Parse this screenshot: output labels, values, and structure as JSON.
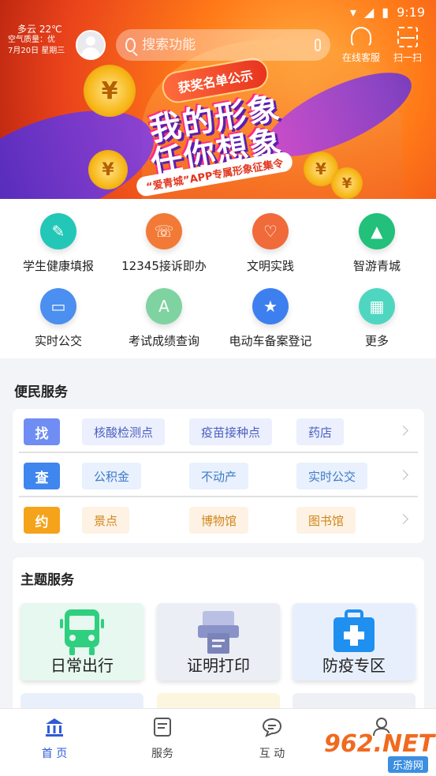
{
  "status": {
    "time": "9:19"
  },
  "header": {
    "weather_line1": "多云 22℃",
    "weather_line2": "空气质量：优",
    "weather_line3": "7月20日 星期三",
    "search_placeholder": "搜索功能",
    "service_label": "在线客服",
    "scan_label": "扫一扫"
  },
  "banner": {
    "tag": "获奖名单公示",
    "line1": "我的形象",
    "line2": "任你想象",
    "sub": "“爱青城”APP专属形象征集令"
  },
  "quick": [
    {
      "label": "学生健康填报",
      "color": "#23c7b7",
      "glyph": "✎"
    },
    {
      "label": "12345接诉即办",
      "color": "#f27a36",
      "glyph": "☏"
    },
    {
      "label": "文明实践",
      "color": "#f06a3a",
      "glyph": "♡"
    },
    {
      "label": "智游青城",
      "color": "#22c07a",
      "glyph": "▲"
    },
    {
      "label": "实时公交",
      "color": "#4b8ff0",
      "glyph": "▭"
    },
    {
      "label": "考试成绩查询",
      "color": "#7fd3a0",
      "glyph": "A"
    },
    {
      "label": "电动车备案登记",
      "color": "#3e7ff0",
      "glyph": "★"
    },
    {
      "label": "更多",
      "color": "#4fd6c0",
      "glyph": "▦"
    }
  ],
  "convenience": {
    "title": "便民服务",
    "rows": [
      {
        "badge": "找",
        "badge_color": "#6f8df3",
        "chip_bg": "#eceffd",
        "chip_color": "#4a5fbf",
        "items": [
          "核酸检测点",
          "疫苗接种点",
          "药店"
        ]
      },
      {
        "badge": "查",
        "badge_color": "#3f86ee",
        "chip_bg": "#e8f1fd",
        "chip_color": "#3f79c8",
        "items": [
          "公积金",
          "不动产",
          "实时公交"
        ]
      },
      {
        "badge": "约",
        "badge_color": "#f5a31a",
        "chip_bg": "#fdf2e3",
        "chip_color": "#d2861c",
        "items": [
          "景点",
          "博物馆",
          "图书馆"
        ]
      }
    ]
  },
  "themes": {
    "title": "主题服务",
    "cards": [
      {
        "label": "日常出行",
        "bg": "#e6f8ef"
      },
      {
        "label": "证明打印",
        "bg": "#eceef6"
      },
      {
        "label": "防疫专区",
        "bg": "#e8effc"
      }
    ]
  },
  "nav": [
    {
      "label": "首 页",
      "active": true
    },
    {
      "label": "服务",
      "active": false
    },
    {
      "label": "互 动",
      "active": false
    },
    {
      "label": "我的",
      "active": false
    }
  ],
  "watermark": {
    "top": "962.NET",
    "bottom": "乐游网"
  }
}
